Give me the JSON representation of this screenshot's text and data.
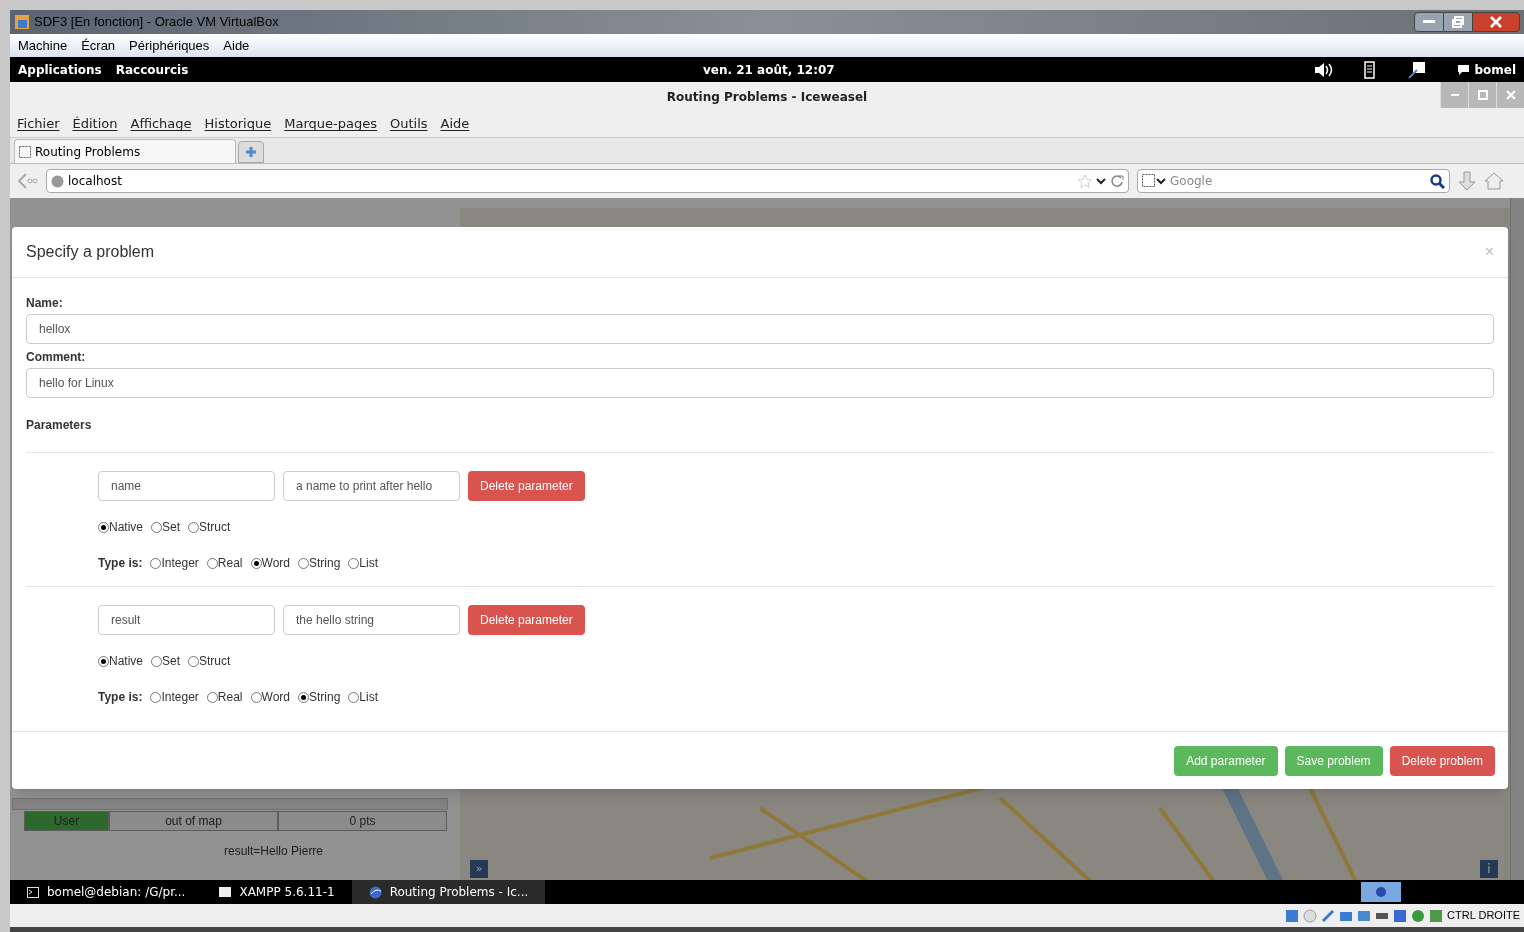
{
  "vbox_window": {
    "title": "SDF3 [En fonction] - Oracle VM VirtualBox",
    "menu": [
      "Machine",
      "Écran",
      "Périphériques",
      "Aide"
    ]
  },
  "top_bar": {
    "menus": [
      "Applications",
      "Raccourcis"
    ],
    "clock": "ven. 21 août, 12:07",
    "user": "bomel"
  },
  "browser": {
    "title": "Routing Problems - Iceweasel",
    "menu": [
      "Fichier",
      "Édition",
      "Affichage",
      "Historique",
      "Marque-pages",
      "Outils",
      "Aide"
    ],
    "tabs": [
      {
        "label": "Routing Problems",
        "selected": true
      }
    ],
    "address": "localhost",
    "search_placeholder": "Google"
  },
  "page_behind": {
    "status": [
      {
        "kind": "user",
        "text": "User"
      },
      {
        "kind": "plain",
        "text": "out of map"
      },
      {
        "kind": "plain",
        "text": "0 pts"
      }
    ],
    "result": "result=Hello Pierre",
    "map_controls": [
      "»",
      "i"
    ]
  },
  "dialog": {
    "title": "Specify a problem",
    "close": "×",
    "fields": [
      {
        "label": "Name:",
        "value": "hellox"
      },
      {
        "label": "Comment:",
        "value": "hello for Linux"
      }
    ],
    "section": "Parameters",
    "parameters": [
      {
        "name": "name",
        "description": "a name to print after hello",
        "delete_label": "Delete parameter",
        "structures": [
          {
            "label": "Native",
            "selected": true
          },
          {
            "label": "Set",
            "selected": false
          },
          {
            "label": "Struct",
            "selected": false
          }
        ],
        "type_label": "Type is:",
        "types": [
          {
            "label": "Integer",
            "selected": false
          },
          {
            "label": "Real",
            "selected": false
          },
          {
            "label": "Word",
            "selected": true
          },
          {
            "label": "String",
            "selected": false
          },
          {
            "label": "List",
            "selected": false
          }
        ]
      },
      {
        "name": "result",
        "description": "the hello string",
        "delete_label": "Delete parameter",
        "structures": [
          {
            "label": "Native",
            "selected": true
          },
          {
            "label": "Set",
            "selected": false
          },
          {
            "label": "Struct",
            "selected": false
          }
        ],
        "type_label": "Type is:",
        "types": [
          {
            "label": "Integer",
            "selected": false
          },
          {
            "label": "Real",
            "selected": false
          },
          {
            "label": "Word",
            "selected": false
          },
          {
            "label": "String",
            "selected": true
          },
          {
            "label": "List",
            "selected": false
          }
        ]
      }
    ],
    "buttons": [
      {
        "label": "Add parameter",
        "kind": "success"
      },
      {
        "label": "Save problem",
        "kind": "success"
      },
      {
        "label": "Delete problem",
        "kind": "danger"
      }
    ]
  },
  "taskbar": [
    {
      "label": "bomel@debian: /G/pr...",
      "kind": "terminal",
      "selected": false
    },
    {
      "label": "XAMPP 5.6.11-1",
      "kind": "window",
      "selected": false
    },
    {
      "label": "Routing Problems - Ic...",
      "kind": "browser",
      "selected": true
    }
  ],
  "vbox_status": {
    "host_key": "CTRL DROITE"
  }
}
